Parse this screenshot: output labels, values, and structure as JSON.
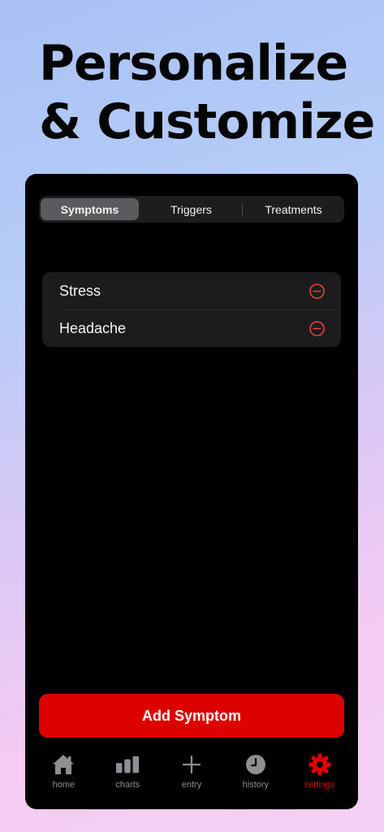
{
  "headline": {
    "line1": "Personalize",
    "line2": "& Customize"
  },
  "segments": [
    {
      "label": "Symptoms",
      "selected": true
    },
    {
      "label": "Triggers",
      "selected": false
    },
    {
      "label": "Treatments",
      "selected": false
    }
  ],
  "items": [
    {
      "label": "Stress"
    },
    {
      "label": "Headache"
    }
  ],
  "add_button": {
    "label": "Add Symptom"
  },
  "tabs": [
    {
      "label": "home",
      "icon": "house-icon"
    },
    {
      "label": "charts",
      "icon": "bar-chart-icon"
    },
    {
      "label": "entry",
      "icon": "plus-icon"
    },
    {
      "label": "history",
      "icon": "clock-icon"
    },
    {
      "label": "settings",
      "icon": "gear-icon",
      "active": true
    }
  ],
  "colors": {
    "accent": "#dd0000",
    "remove": "#e5423c",
    "tab_inactive": "#8e8e93",
    "tab_active": "#e00000"
  }
}
